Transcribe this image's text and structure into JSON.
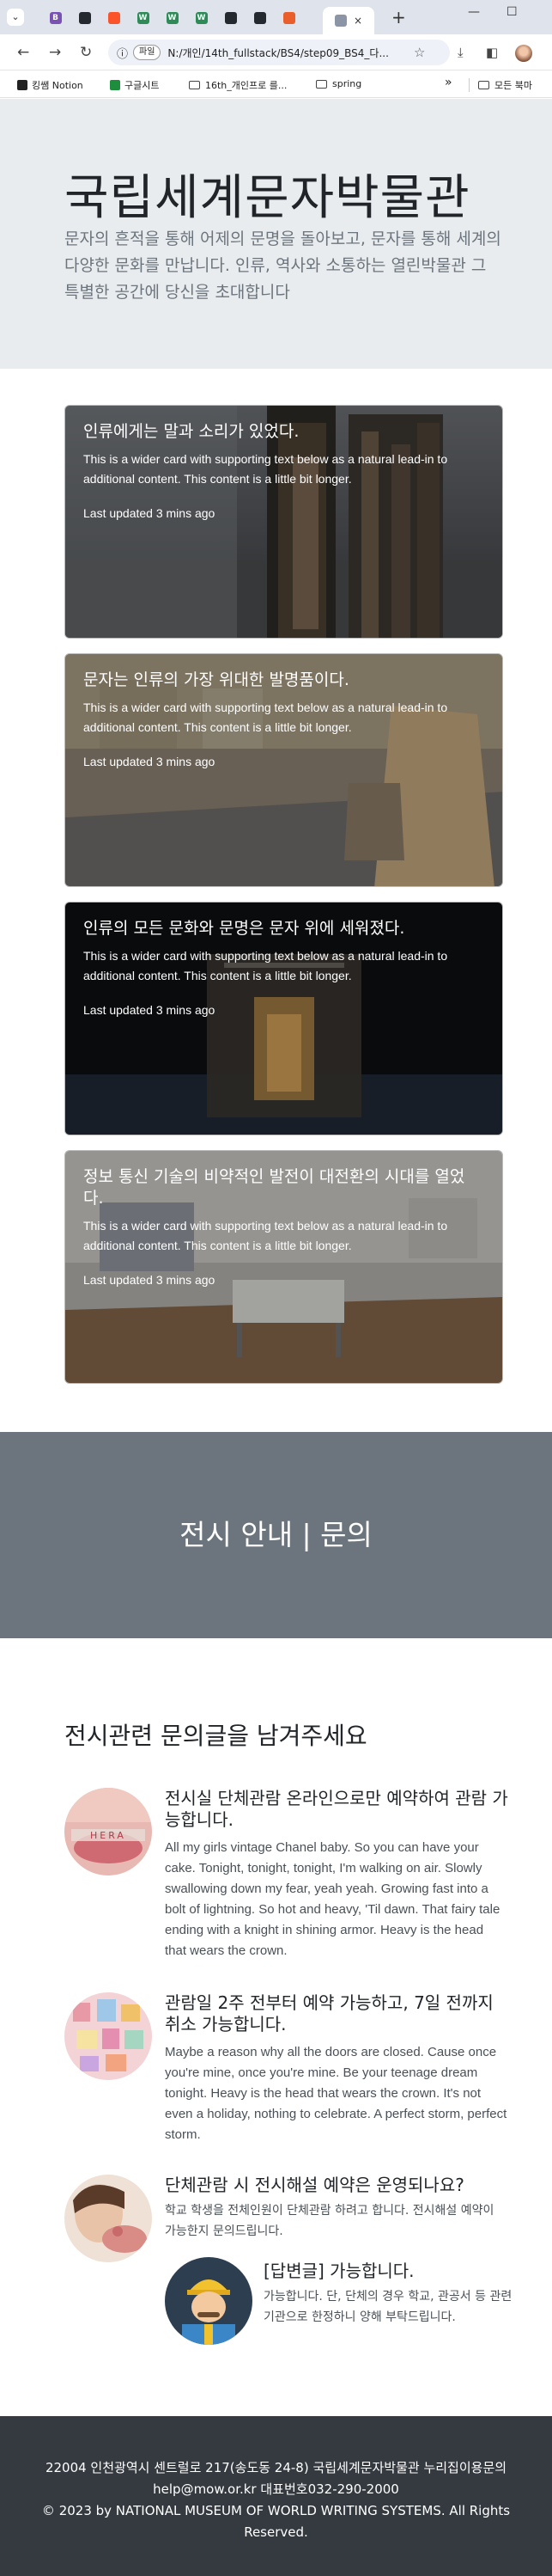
{
  "browser": {
    "tab_menu_icon": "chevron-down",
    "tabs": [
      {
        "icon": "bootstrap-favicon",
        "letter": "B",
        "color": "#7952b3"
      },
      {
        "icon": "github-favicon",
        "letter": "",
        "color": "#24292f"
      },
      {
        "icon": "brave-favicon",
        "letter": "",
        "color": "#fb542b"
      },
      {
        "icon": "w-favicon",
        "letter": "W",
        "color": "#2e8b57"
      },
      {
        "icon": "w-favicon",
        "letter": "W",
        "color": "#2e8b57"
      },
      {
        "icon": "w-favicon",
        "letter": "W",
        "color": "#2e8b57"
      },
      {
        "icon": "github-favicon",
        "letter": "",
        "color": "#24292f"
      },
      {
        "icon": "github-favicon",
        "letter": "",
        "color": "#24292f"
      },
      {
        "icon": "notion-favicon",
        "letter": "",
        "color": "#e95e2a"
      },
      {
        "icon": "page-favicon",
        "letter": "",
        "color": "#8b95a5"
      }
    ],
    "active_tab_close": "×",
    "new_tab": "+",
    "address_chip": "파일",
    "address": "N:/개인/14th_fullstack/BS4/step09_BS4_다...",
    "bookmarks": [
      {
        "label": "킹쌤 Notion",
        "icon": "notion-icon"
      },
      {
        "label": "구글시트",
        "icon": "sheets-icon"
      },
      {
        "label": "16th_개인프로 를...",
        "icon": "folder-icon"
      },
      {
        "label": "spring",
        "icon": "folder-icon"
      }
    ],
    "bookmarks_more": "»",
    "all_bookmarks": "모든 북마"
  },
  "hero": {
    "title": "국립세계문자박물관",
    "lead": "문자의 흔적을 통해 어제의 문명을 돌아보고, 문자를 통해 세계의 다양한 문화를 만납니다. 인류, 역사와 소통하는 열린박물관 그 특별한 공간에 당신을 초대합니다"
  },
  "cards": [
    {
      "title": "인류에게는 말과 소리가 있었다.",
      "text": "This is a wider card with supporting text below as a natural lead-in to additional content. This content is a little bit longer.",
      "updated": "Last updated 3 mins ago"
    },
    {
      "title": "문자는 인류의 가장 위대한 발명품이다.",
      "text": "This is a wider card with supporting text below as a natural lead-in to additional content. This content is a little bit longer.",
      "updated": "Last updated 3 mins ago"
    },
    {
      "title": "인류의 모든 문화와 문명은 문자 위에 세워졌다.",
      "text": "This is a wider card with supporting text below as a natural lead-in to additional content. This content is a little bit longer.",
      "updated": "Last updated 3 mins ago"
    },
    {
      "title": "정보 통신 기술의 비약적인 발전이 대전환의 시대를 열었다.",
      "text": "This is a wider card with supporting text below as a natural lead-in to additional content. This content is a little bit longer.",
      "updated": "Last updated 3 mins ago"
    }
  ],
  "section_band": {
    "title": "전시 안내 | 문의"
  },
  "inquiry": {
    "title": "전시관련 문의글을 남겨주세요",
    "items": [
      {
        "thumb_label": "HERA",
        "title": "전시실 단체관람 온라인으로만 예약하여 관람 가능합니다.",
        "text": "All my girls vintage Chanel baby. So you can have your cake. Tonight, tonight, tonight, I'm walking on air. Slowly swallowing down my fear, yeah yeah. Growing fast into a bolt of lightning. So hot and heavy, 'Til dawn. That fairy tale ending with a knight in shining armor. Heavy is the head that wears the crown."
      },
      {
        "title": "관람일 2주 전부터 예약 가능하고, 7일 전까지 취소 가능합니다.",
        "text": "Maybe a reason why all the doors are closed. Cause once you're mine, once you're mine. Be your teenage dream tonight. Heavy is the head that wears the crown. It's not even a holiday, nothing to celebrate. A perfect storm, perfect storm."
      },
      {
        "title": "단체관람 시 전시해설 예약은 운영되나요?",
        "text": "학교 학생을 전체인원이 단체관람 하려고 합니다. 전시해설 예약이 가능한지 문의드립니다.",
        "reply": {
          "title": "[답변글] 가능합니다.",
          "text": "가능합니다. 단, 단체의 경우 학교, 관공서 등 관련 기관으로 한정하니 양해 부탁드립니다."
        }
      }
    ]
  },
  "footer": {
    "address": "22004 인천광역시 센트럴로 217(송도동 24-8) 국립세계문자박물관 누리집이용문의help@mow.or.kr 대표번호032-290-2000",
    "copyright": "© 2023 by NATIONAL MUSEUM OF WORLD WRITING SYSTEMS. All Rights Reserved."
  }
}
